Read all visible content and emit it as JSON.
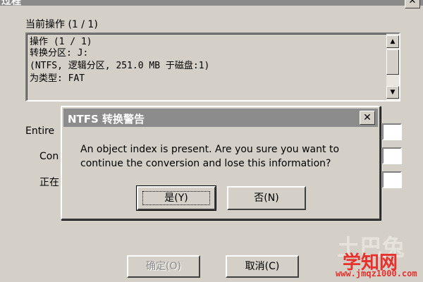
{
  "background_window": {
    "title": "过程",
    "close_glyph": "✕",
    "current_operation_label": "当前操作 (1 / 1)",
    "details": [
      "操作 (1 / 1)",
      " 转换分区: J:",
      "    (NTFS, 逻辑分区, 251.0 MB 于磁盘:1)",
      "    为类型: FAT"
    ],
    "scroll_up_glyph": "▲",
    "scroll_down_glyph": "▼",
    "progress_labels": [
      "Entire",
      "Con",
      "正在"
    ],
    "ok_label": "确定(O)",
    "cancel_label": "取消(C)"
  },
  "dialog": {
    "title": "NTFS 转换警告",
    "close_glyph": "✕",
    "message_line1": "An object index is present.  Are you sure you want to",
    "message_line2": "continue the conversion and lose this information?",
    "yes_label": "是(Y)",
    "no_label": "否(N)"
  },
  "watermark": {
    "brand_faint": "土巴兔",
    "brand": "学知网",
    "url": "www.jmqz1000.com"
  }
}
